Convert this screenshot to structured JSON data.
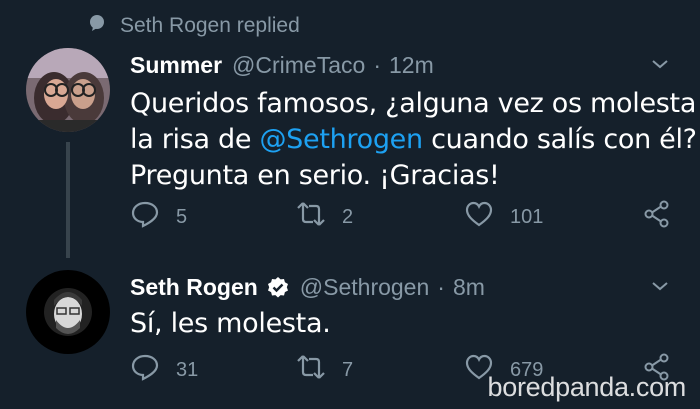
{
  "context": {
    "icon": "speech-bubble-icon",
    "label": "Seth Rogen replied"
  },
  "tweets": [
    {
      "name": "Summer",
      "handle": "@CrimeTaco",
      "separator": "·",
      "time": "12m",
      "text_lines": [
        [
          "Queridos famosos, ¿alguna vez os molesta"
        ],
        [
          "la risa de ",
          "@Sethrogen",
          " cuando salís con él?"
        ],
        [
          "Pregunta en serio. ¡Gracias!"
        ]
      ],
      "replies": "5",
      "retweets": "2",
      "likes": "101"
    },
    {
      "name": "Seth Rogen",
      "handle": "@Sethrogen",
      "separator": "·",
      "time": "8m",
      "verified": true,
      "text": "Sí, les molesta.",
      "replies": "31",
      "retweets": "7",
      "likes": "679"
    }
  ],
  "watermark": "boredpanda.com",
  "colors": {
    "background": "#15202b",
    "secondary_text": "#8899a6",
    "mention": "#1da1f2",
    "thread_line": "#38444d"
  }
}
